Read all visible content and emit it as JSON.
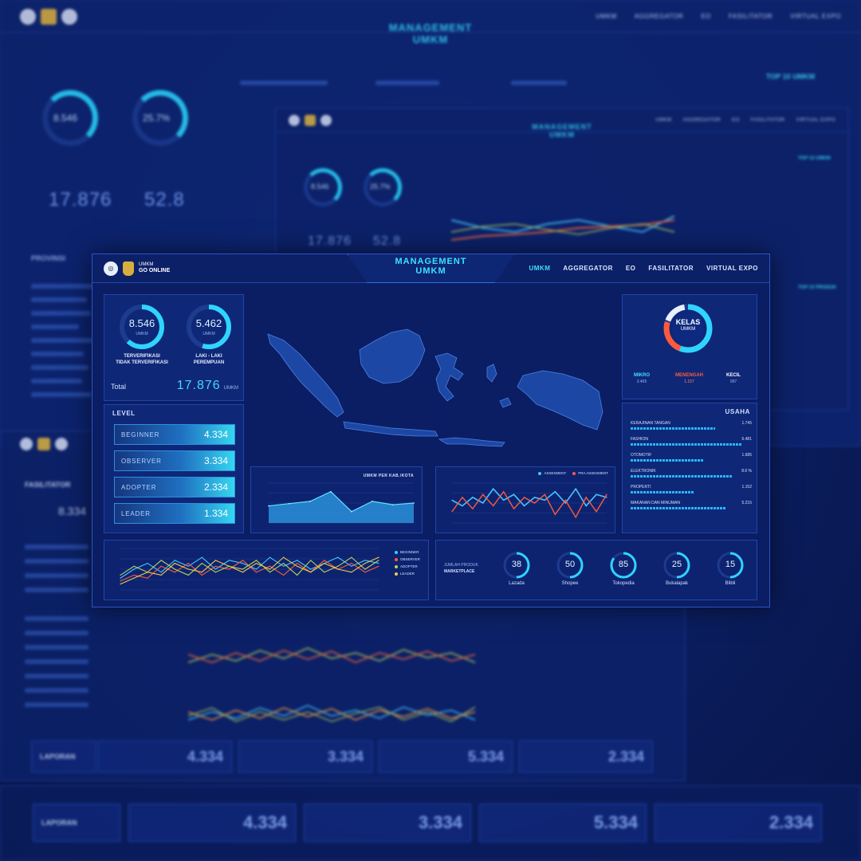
{
  "background": {
    "top": {
      "title_line1": "MANAGEMENT",
      "title_line2": "UMKM",
      "nav": [
        "UMKM",
        "AGGREGATOR",
        "EO",
        "FASILITATOR",
        "VIRTUAL EXPO"
      ],
      "gauge1": "8.546",
      "gauge2": "25.7%",
      "big1": "17.876",
      "big2": "52.8",
      "label_provinsi": "PROVINSI",
      "label_top": "TOP 10 UMKM"
    },
    "right": {
      "title_line1": "MANAGEMENT",
      "title_line2": "UMKM",
      "nav": [
        "UMKM",
        "AGGREGATOR",
        "EO",
        "FASILITATOR",
        "VIRTUAL EXPO"
      ],
      "gauge1": "8.546",
      "gauge2": "25.7%",
      "big1": "17.876",
      "big2": "52.8",
      "label_top": "TOP 10 UMKM",
      "label_top2": "TOP 10 PRODUK"
    },
    "left": {
      "label": "FASILITATOR",
      "value": "8.334"
    },
    "stats_mid": [
      {
        "label": "LAPORAN",
        "value": ""
      },
      {
        "label": "",
        "value": "4.334"
      },
      {
        "label": "",
        "value": "3.334"
      },
      {
        "label": "",
        "value": "5.334"
      },
      {
        "label": "",
        "value": "2.334"
      }
    ],
    "stats_bottom": [
      {
        "label": "LAPORAN",
        "value": ""
      },
      {
        "label": "",
        "value": "4.334"
      },
      {
        "label": "",
        "value": "3.334"
      },
      {
        "label": "",
        "value": "5.334"
      },
      {
        "label": "",
        "value": "2.334"
      }
    ]
  },
  "main": {
    "logo_text_top": "UMKM",
    "logo_text_bottom": "GO ONLINE",
    "title_line1": "MANAGEMENT",
    "title_line2": "UMKM",
    "nav": {
      "umkm": "UMKM",
      "aggregator": "AGGREGATOR",
      "eo": "EO",
      "fasilitator": "FASILITATOR",
      "virtual_expo": "VIRTUAL EXPO"
    },
    "verif": {
      "value": "8.546",
      "unit": "UMKM",
      "label_line1": "TERVERIFIKASI",
      "label_line2": "TIDAK TERVERIFIKASI",
      "fill": 0.62
    },
    "gender": {
      "value": "5.462",
      "unit": "UMKM",
      "label_line1": "LAKI - LAKI",
      "label_line2": "PEREMPUAN",
      "fill": 0.55
    },
    "total": {
      "label": "Total",
      "value": "17.876",
      "unit": "UMKM"
    },
    "level": {
      "title": "LEVEL",
      "items": [
        {
          "name": "BEGINNER",
          "value": "4.334"
        },
        {
          "name": "OBSERVER",
          "value": "3.334"
        },
        {
          "name": "ADOPTER",
          "value": "2.334"
        },
        {
          "name": "LEADER",
          "value": "1.334"
        }
      ]
    },
    "kelas": {
      "title_line1": "KELAS",
      "title_line2": "UMKM",
      "items": [
        {
          "name": "MIKRO",
          "value": "3.465",
          "color": "#3ee0ff"
        },
        {
          "name": "MENENGAH",
          "value": "1.157",
          "color": "#ff5a3c"
        },
        {
          "name": "KECIL",
          "value": "997",
          "color": "#ffffff"
        }
      ]
    },
    "usaha": {
      "title": "USAHA",
      "items": [
        {
          "name": "KERAJINAN TANGAN",
          "value": "1.745"
        },
        {
          "name": "FASHION",
          "value": "6.481"
        },
        {
          "name": "OTOMOTIF",
          "value": "1.685"
        },
        {
          "name": "ELEKTRONIK",
          "value": "8.6 %"
        },
        {
          "name": "PROPERTI",
          "value": "1.152"
        },
        {
          "name": "MAKANAN DAN MINUMAN",
          "value": "5.215"
        }
      ]
    },
    "area_chart": {
      "title": "UMKM PER KAB./KOTA"
    },
    "compare_chart": {
      "legend": [
        "ASSESMENT",
        "PRA ASSESMENT"
      ]
    },
    "level_chart": {
      "legend": [
        "BEGINNER",
        "OBSERVER",
        "ADOPTER",
        "LEADER"
      ]
    },
    "marketplace": {
      "label_line1": "JUMLAH PRODUK",
      "label_line2": "MARKETPLACE",
      "items": [
        {
          "name": "Lazada",
          "value": "38",
          "fill": 0.38
        },
        {
          "name": "Shopee",
          "value": "50",
          "fill": 0.5
        },
        {
          "name": "Tokopedia",
          "value": "85",
          "fill": 0.85
        },
        {
          "name": "Bukalapak",
          "value": "25",
          "fill": 0.25
        },
        {
          "name": "Blibli",
          "value": "15",
          "fill": 0.15
        }
      ]
    }
  },
  "chart_data": [
    {
      "type": "area",
      "title": "UMKM PER KAB./KOTA",
      "categories": [
        "",
        "",
        "",
        "",
        "",
        "",
        "",
        ""
      ],
      "series": [
        {
          "values": [
            30,
            34,
            38,
            55,
            20,
            38,
            32,
            35
          ]
        }
      ],
      "ylim": [
        0,
        70
      ]
    },
    {
      "type": "line",
      "categories": [
        "",
        "",
        "",
        "",
        "",
        "",
        "",
        "",
        "",
        "",
        "",
        "",
        "",
        "",
        "",
        ""
      ],
      "series": [
        {
          "name": "ASSESMENT",
          "values": [
            40,
            30,
            45,
            35,
            60,
            40,
            50,
            30,
            45,
            40,
            55,
            35,
            60,
            30,
            50,
            45
          ]
        },
        {
          "name": "PRA ASSESMENT",
          "values": [
            20,
            45,
            25,
            50,
            30,
            55,
            25,
            45,
            35,
            50,
            15,
            40,
            10,
            45,
            20,
            50
          ]
        }
      ],
      "ylim": [
        0,
        70
      ]
    },
    {
      "type": "line",
      "categories": [
        "",
        "",
        "",
        "",
        "",
        "",
        "",
        "",
        "",
        "",
        "",
        "",
        "",
        "",
        "",
        "",
        "",
        "",
        "",
        ""
      ],
      "series": [
        {
          "name": "BEGINNER",
          "values": [
            20,
            35,
            45,
            30,
            50,
            40,
            55,
            35,
            50,
            45,
            35,
            55,
            40,
            50,
            35,
            45,
            55,
            40,
            50,
            45
          ]
        },
        {
          "name": "OBSERVER",
          "values": [
            15,
            25,
            20,
            40,
            30,
            45,
            25,
            40,
            35,
            50,
            30,
            40,
            25,
            45,
            30,
            50,
            35,
            45,
            30,
            40
          ]
        },
        {
          "name": "ADOPTER",
          "values": [
            25,
            40,
            30,
            50,
            35,
            25,
            45,
            30,
            40,
            35,
            50,
            30,
            45,
            25,
            50,
            30,
            40,
            55,
            35,
            50
          ]
        },
        {
          "name": "LEADER",
          "values": [
            10,
            20,
            30,
            25,
            45,
            35,
            30,
            50,
            40,
            30,
            45,
            35,
            55,
            40,
            30,
            45,
            35,
            30,
            45,
            55
          ]
        }
      ],
      "ylim": [
        0,
        70
      ]
    }
  ]
}
